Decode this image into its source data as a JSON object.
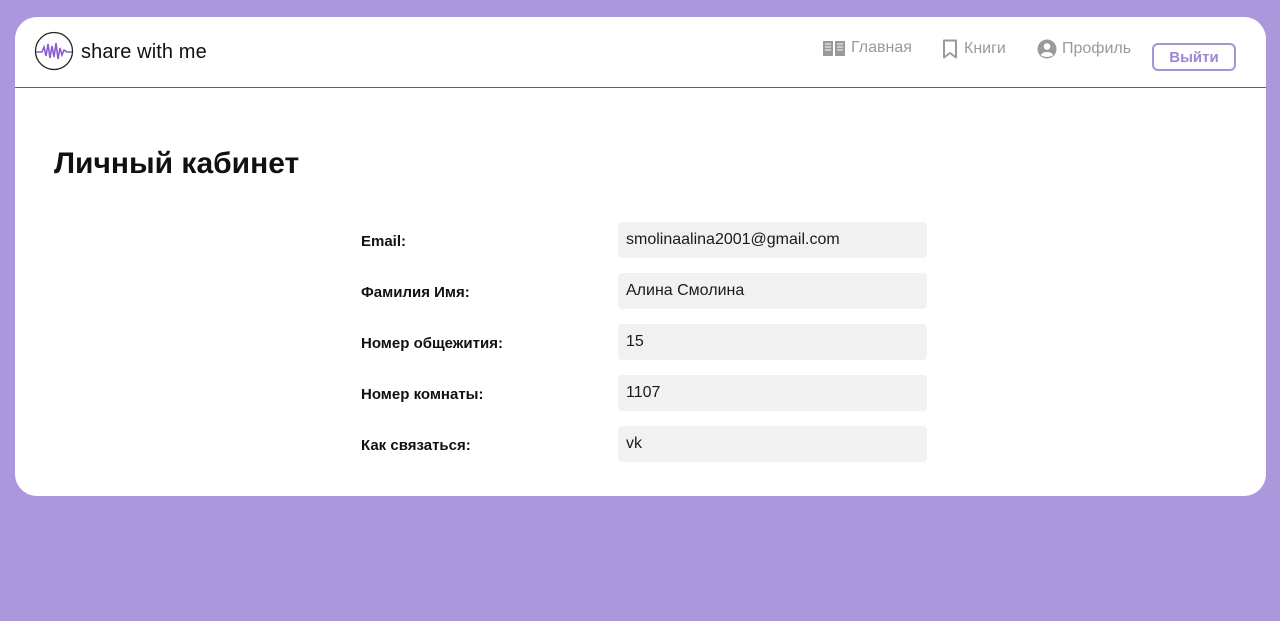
{
  "header": {
    "brand": "share with me",
    "logo_icon": "sound-wave-logo-icon",
    "nav": {
      "home": {
        "label": "Главная",
        "icon": "open-book-icon"
      },
      "books": {
        "label": "Книги",
        "icon": "bookmark-icon"
      },
      "profile": {
        "label": "Профиль",
        "icon": "user-circle-icon"
      }
    },
    "logout_label": "Выйти"
  },
  "page": {
    "title": "Личный кабинет"
  },
  "profile": {
    "email": {
      "label": "Email:",
      "value": "smolinaalina2001@gmail.com"
    },
    "name": {
      "label": "Фамилия Имя:",
      "value": "Алина Смолина"
    },
    "dorm": {
      "label": "Номер общежития:",
      "value": "15"
    },
    "room": {
      "label": "Номер комнаты:",
      "value": "1107"
    },
    "contact": {
      "label": "Как связаться:",
      "value": "vk"
    }
  },
  "colors": {
    "background": "#ab98dc",
    "accent": "#9d86d2",
    "divider": "#6b4cc4",
    "field_bg": "#f1f1f1"
  }
}
